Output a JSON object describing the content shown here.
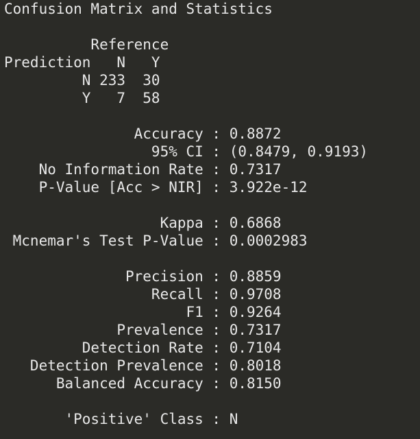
{
  "console": {
    "lines": [
      "Confusion Matrix and Statistics",
      "",
      "          Reference",
      "Prediction   N   Y",
      "         N 233  30",
      "         Y   7  58",
      "",
      "               Accuracy : 0.8872",
      "                 95% CI : (0.8479, 0.9193)",
      "    No Information Rate : 0.7317",
      "    P-Value [Acc > NIR] : 3.922e-12",
      "",
      "                  Kappa : 0.6868",
      " Mcnemar's Test P-Value : 0.0002983",
      "",
      "              Precision : 0.8859",
      "                 Recall : 0.9708",
      "                     F1 : 0.9264",
      "             Prevalence : 0.7317",
      "         Detection Rate : 0.7104",
      "   Detection Prevalence : 0.8018",
      "      Balanced Accuracy : 0.8150",
      "",
      "       'Positive' Class : N"
    ]
  },
  "colors": {
    "background": "#2b2b27",
    "text": "#e8e8e8"
  }
}
